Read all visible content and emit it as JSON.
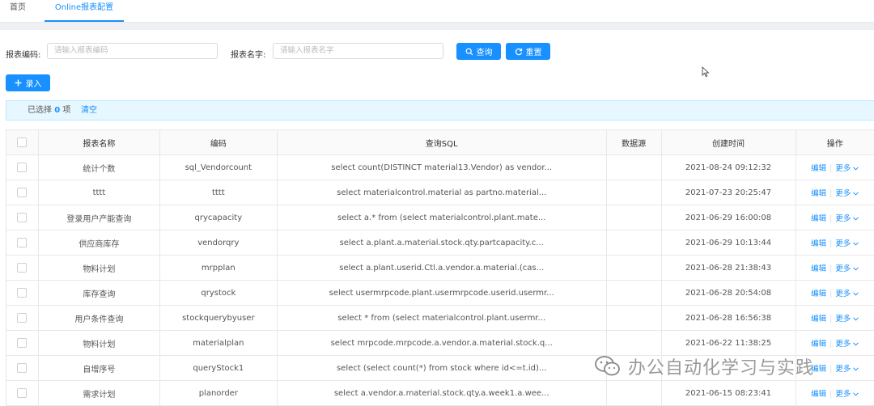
{
  "tabs": {
    "home": "首页",
    "active": "Online报表配置"
  },
  "search": {
    "code_label": "报表编码:",
    "code_placeholder": "请输入报表编码",
    "name_label": "报表名字:",
    "name_placeholder": "请输入报表名字",
    "query_label": "查询",
    "reset_label": "重置"
  },
  "toolbar": {
    "add_label": "录入"
  },
  "selection": {
    "prefix": "已选择",
    "count": "0",
    "suffix": "项",
    "clear": "清空"
  },
  "table": {
    "headers": [
      "报表名称",
      "编码",
      "查询SQL",
      "数据源",
      "创建时间",
      "操作"
    ],
    "edit_label": "编辑",
    "more_label": "更多",
    "rows": [
      {
        "name": "统计个数",
        "code": "sql_Vendorcount",
        "sql": "select count(DISTINCT material13.Vendor) as vendor...",
        "source": "",
        "time": "2021-08-24 09:12:32"
      },
      {
        "name": "tttt",
        "code": "tttt",
        "sql": "select materialcontrol.material as partno.material...",
        "source": "",
        "time": "2021-07-23 20:25:47"
      },
      {
        "name": "登录用户产能查询",
        "code": "qrycapacity",
        "sql": "select a.* from (select materialcontrol.plant.mate...",
        "source": "",
        "time": "2021-06-29 16:00:08"
      },
      {
        "name": "供应商库存",
        "code": "vendorqry",
        "sql": "select a.plant.a.material.stock.qty.partcapacity.c...",
        "source": "",
        "time": "2021-06-29 10:13:44"
      },
      {
        "name": "物料计划",
        "code": "mrpplan",
        "sql": "select a.plant.userid.Ctl.a.vendor.a.material.(cas...",
        "source": "",
        "time": "2021-06-28 21:38:43"
      },
      {
        "name": "库存查询",
        "code": "qrystock",
        "sql": "select usermrpcode.plant.usermrpcode.userid.usermr...",
        "source": "",
        "time": "2021-06-28 20:54:08"
      },
      {
        "name": "用户条件查询",
        "code": "stockquerybyuser",
        "sql": "select * from (select materialcontrol.plant.usermr...",
        "source": "",
        "time": "2021-06-28 16:56:38"
      },
      {
        "name": "物料计划",
        "code": "materialplan",
        "sql": "select mrpcode.mrpcode.a.vendor.a.material.stock.q...",
        "source": "",
        "time": "2021-06-22 11:38:25"
      },
      {
        "name": "自增序号",
        "code": "queryStock1",
        "sql": "select (select count(*) from stock where id<=t.id)...",
        "source": "",
        "time": ""
      },
      {
        "name": "需求计划",
        "code": "planorder",
        "sql": "select a.vendor.a.material.stock.qty.a.week1.a.wee...",
        "source": "",
        "time": "2021-06-15 08:23:41"
      }
    ]
  },
  "watermark": {
    "text": "办公自动化学习与实践"
  },
  "colors": {
    "accent": "#1890ff",
    "alert_bg": "#e6f7ff"
  }
}
